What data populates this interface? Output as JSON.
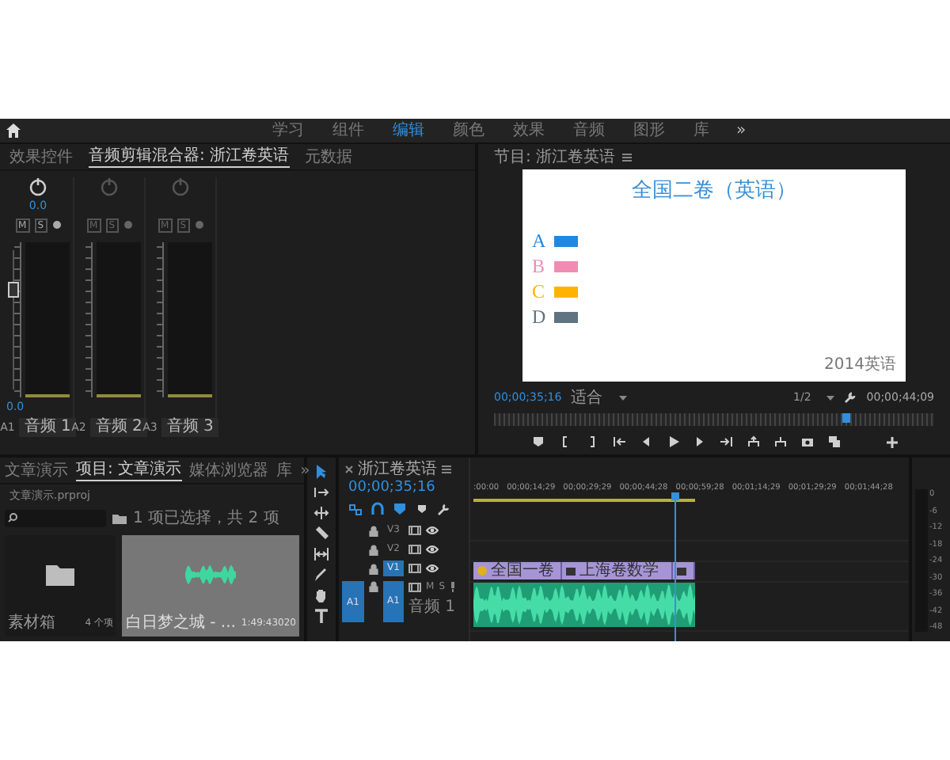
{
  "workspaces": {
    "items": [
      {
        "label": "学习",
        "selected": false
      },
      {
        "label": "组件",
        "selected": false
      },
      {
        "label": "编辑",
        "selected": true
      },
      {
        "label": "颜色",
        "selected": false
      },
      {
        "label": "效果",
        "selected": false
      },
      {
        "label": "音频",
        "selected": false
      },
      {
        "label": "图形",
        "selected": false
      },
      {
        "label": "库",
        "selected": false
      }
    ],
    "more": "»"
  },
  "mixer": {
    "tabs": [
      {
        "label": "效果控件",
        "selected": false
      },
      {
        "label": "音频剪辑混合器: 浙江卷英语",
        "selected": true
      },
      {
        "label": "元数据",
        "selected": false
      }
    ],
    "channels": [
      {
        "track": "A1",
        "name": "音频 1",
        "active": true,
        "pan": "0.0",
        "fader": "0.0",
        "level": 0.72,
        "buttons": [
          "M",
          "S"
        ]
      },
      {
        "track": "A2",
        "name": "音频 2",
        "active": false,
        "buttons": [
          "M",
          "S"
        ]
      },
      {
        "track": "A3",
        "name": "音频 3",
        "active": false,
        "buttons": [
          "M",
          "S"
        ]
      }
    ]
  },
  "monitor": {
    "title": "节目: 浙江卷英语",
    "slide": {
      "title": "全国二卷（英语）",
      "options": [
        {
          "letter": "A",
          "color": "#1e88e5"
        },
        {
          "letter": "B",
          "color": "#f08cb4"
        },
        {
          "letter": "C",
          "color": "#ffb300"
        },
        {
          "letter": "D",
          "color": "#5f7480"
        }
      ],
      "footer": "2014英语"
    },
    "timecode": "00;00;35;16",
    "zoom": "适合",
    "resolution": "1/2",
    "duration": "00;00;44;09",
    "playhead": {
      "level": 0.8
    }
  },
  "project": {
    "tabs": [
      {
        "label": "文章演示",
        "selected": false
      },
      {
        "label": "项目: 文章演示",
        "selected": true
      },
      {
        "label": "媒体浏览器",
        "selected": false
      },
      {
        "label": "库",
        "selected": false
      }
    ],
    "more": "»",
    "file": "文章演示.prproj",
    "selection": "1 项已选择，共 2 项",
    "items": [
      {
        "kind": "bin",
        "name": "素材箱",
        "detail": "4 个项",
        "selected": false
      },
      {
        "kind": "audio",
        "name": "白日梦之城 - ...",
        "detail": "1:49:43020",
        "selected": true
      }
    ]
  },
  "tools": [
    {
      "kind": "selection",
      "selected": true
    },
    {
      "kind": "track-select",
      "selected": false
    },
    {
      "kind": "ripple",
      "selected": false
    },
    {
      "kind": "razor",
      "selected": false
    },
    {
      "kind": "slip",
      "selected": false
    },
    {
      "kind": "pen",
      "selected": false
    },
    {
      "kind": "hand",
      "selected": false
    },
    {
      "kind": "type",
      "selected": false
    }
  ],
  "timeline": {
    "title": "浙江卷英语",
    "timecode": "00;00;35;16",
    "ruler": [
      ":00:00",
      "00;00;14;29",
      "00;00;29;29",
      "00;00;44;28",
      "00;00;59;28",
      "00;01;14;29",
      "00;01;29;29",
      "00;01;44;28"
    ],
    "playhead": {
      "level": 0.466
    },
    "tracks": [
      {
        "kind": "video",
        "label": "V3",
        "targeted": false
      },
      {
        "kind": "video",
        "label": "V2",
        "targeted": false
      },
      {
        "kind": "video",
        "label": "V1",
        "targeted": true,
        "clips": [
          {
            "kind": "effect",
            "label": "全国一卷"
          },
          {
            "kind": "plain",
            "label": "上海卷数学"
          },
          {
            "kind": "plain"
          }
        ]
      },
      {
        "kind": "audio",
        "label": "A1",
        "targeted": true,
        "source": "A1",
        "buttons": [
          "M",
          "S"
        ],
        "name": "音频 1",
        "clips": [
          {
            "kind": "audio"
          }
        ]
      }
    ]
  },
  "meters": {
    "scale": [
      "0",
      "-6",
      "-12",
      "-18",
      "-24",
      "-30",
      "-36",
      "-42",
      "-48"
    ]
  }
}
